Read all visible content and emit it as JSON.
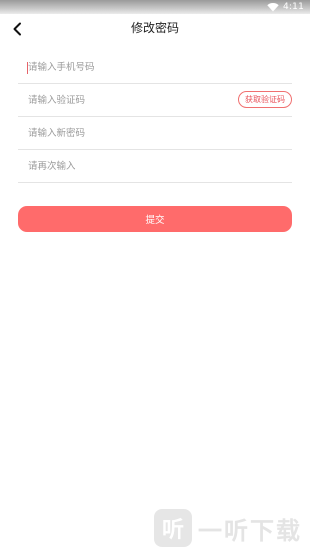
{
  "status_bar": {
    "time": "4:11",
    "wifi_icon": "wifi-icon"
  },
  "nav": {
    "back_icon": "chevron-left-icon",
    "title": "修改密码"
  },
  "form": {
    "phone_placeholder": "请输入手机号码",
    "code_placeholder": "请输入验证码",
    "get_code_label": "获取验证码",
    "new_password_placeholder": "请输入新密码",
    "confirm_password_placeholder": "请再次输入"
  },
  "submit_label": "提交",
  "watermark": {
    "logo_glyph": "听",
    "text": "一听下载"
  },
  "colors": {
    "accent": "#ff6b6b",
    "accent_border": "#f07070",
    "divider": "#e4e4e4",
    "placeholder": "#9a9a9a"
  }
}
